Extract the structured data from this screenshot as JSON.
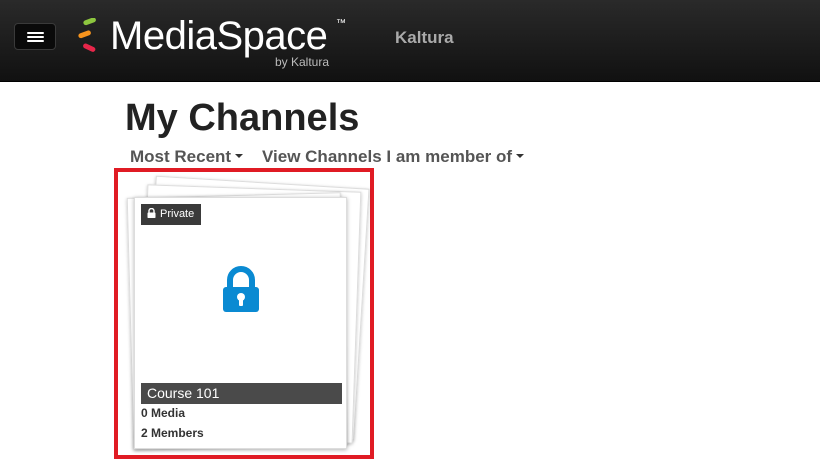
{
  "header": {
    "menu_icon": "hamburger-icon",
    "logo_text": "MediaSpace",
    "logo_tm": "™",
    "logo_subtext": "by Kaltura",
    "site_name": "Kaltura",
    "logo_colors": [
      "#8dc63f",
      "#f7941d",
      "#e8264a"
    ]
  },
  "page": {
    "title": "My Channels",
    "filters": [
      {
        "label": "Most Recent"
      },
      {
        "label": "View Channels I am member of"
      }
    ]
  },
  "channels": [
    {
      "badge": "Private",
      "badge_icon": "lock-icon",
      "thumbnail_icon": "lock-icon",
      "thumbnail_color": "#0a8ad2",
      "title": "Course 101",
      "media": "0 Media",
      "members": "2 Members"
    }
  ],
  "highlight_color": "#e01b24"
}
